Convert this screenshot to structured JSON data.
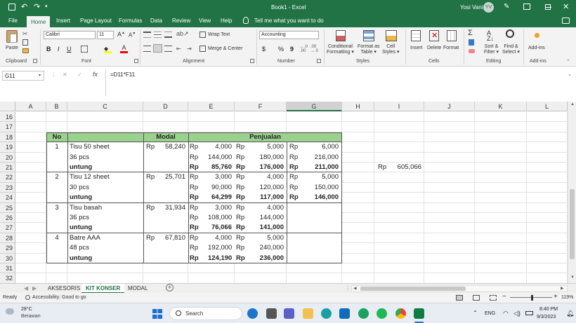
{
  "titlebar": {
    "title": "Book1  -  Excel",
    "user": "Yosi Vani",
    "avatar": "YV"
  },
  "menu": {
    "items": [
      "File",
      "Home",
      "Insert",
      "Page Layout",
      "Formulas",
      "Data",
      "Review",
      "View",
      "Help"
    ],
    "active": "Home",
    "tell_me": "Tell me what you want to do"
  },
  "ribbon": {
    "clipboard": {
      "paste": "Paste",
      "label": "Clipboard"
    },
    "font": {
      "name": "Calibri",
      "size": "11",
      "bold": "B",
      "italic": "I",
      "underline": "U",
      "label": "Font"
    },
    "alignment": {
      "wrap": "Wrap Text",
      "merge": "Merge & Center",
      "label": "Alignment"
    },
    "number": {
      "format": "Accounting",
      "currency": "$",
      "percent": "%",
      "comma": "9",
      "label": "Number"
    },
    "styles": {
      "conditional": [
        "Conditional",
        "Formatting"
      ],
      "format_table": [
        "Format as",
        "Table"
      ],
      "cell_styles": [
        "Cell",
        "Styles"
      ],
      "label": "Styles"
    },
    "cells": {
      "insert": "Insert",
      "delete": "Delete",
      "format": "Format",
      "label": "Cells"
    },
    "editing": {
      "sort": [
        "Sort &",
        "Filter"
      ],
      "find": [
        "Find &",
        "Select"
      ],
      "label": "Editing"
    },
    "addins": {
      "name": "Add-ins",
      "label": "Add-ins"
    }
  },
  "formula_bar": {
    "name_box": "G11",
    "cancel": "✕",
    "enter": "✓",
    "fx": "fx",
    "formula": "=D11*F11"
  },
  "columns": [
    "A",
    "B",
    "C",
    "D",
    "E",
    "F",
    "G",
    "H",
    "I",
    "J",
    "K",
    "L"
  ],
  "rows": [
    "16",
    "17",
    "18",
    "19",
    "20",
    "21",
    "22",
    "23",
    "24",
    "25",
    "26",
    "27",
    "28",
    "29",
    "30",
    "31",
    "32"
  ],
  "table": {
    "headers": {
      "no": "No",
      "modal": "Modal",
      "penjualan": "Penjualan"
    },
    "currency": "Rp",
    "items": [
      {
        "no": "1",
        "name": "Tisu 50 sheet",
        "modal": "58,240",
        "qty": "36 pcs",
        "sub": "untung",
        "prices": [
          "4,000",
          "5,000",
          "6,000"
        ],
        "revenue": [
          "144,000",
          "180,000",
          "216,000"
        ],
        "profit": [
          "85,760",
          "176,000",
          "211,000"
        ]
      },
      {
        "no": "2",
        "name": "Tisu 12 sheet",
        "modal": "25,701",
        "qty": "30 pcs",
        "sub": "untung",
        "prices": [
          "3,000",
          "4,000",
          "5,000"
        ],
        "revenue": [
          "90,000",
          "120,000",
          "150,000"
        ],
        "profit": [
          "64,299",
          "117,000",
          "146,000"
        ]
      },
      {
        "no": "3",
        "name": "Tisu basah",
        "modal": "31,934",
        "qty": "36 pcs",
        "sub": "untung",
        "prices": [
          "3,000",
          "4,000"
        ],
        "revenue": [
          "108,000",
          "144,000"
        ],
        "profit": [
          "76,066",
          "141,000"
        ]
      },
      {
        "no": "4",
        "name": "Batre AAA",
        "modal": "67,810",
        "qty": "48 pcs",
        "sub": "untung",
        "prices": [
          "4,000",
          "5,000"
        ],
        "revenue": [
          "192,000",
          "240,000"
        ],
        "profit": [
          "124,190",
          "236,000"
        ]
      }
    ],
    "total": {
      "currency": "Rp",
      "value": "605,066"
    }
  },
  "sheets": {
    "tabs": [
      "AKSESORIS",
      "KIT KONSER",
      "MODAL"
    ],
    "active": "KIT KONSER",
    "add": "+"
  },
  "status": {
    "ready": "Ready",
    "accessibility": "Accessibility: Good to go",
    "zoom": "119%"
  },
  "taskbar": {
    "weather_temp": "28°C",
    "weather_desc": "Berawan",
    "search": "Search",
    "lang": "ENG",
    "time": "8:40 PM",
    "date": "9/3/2023"
  }
}
